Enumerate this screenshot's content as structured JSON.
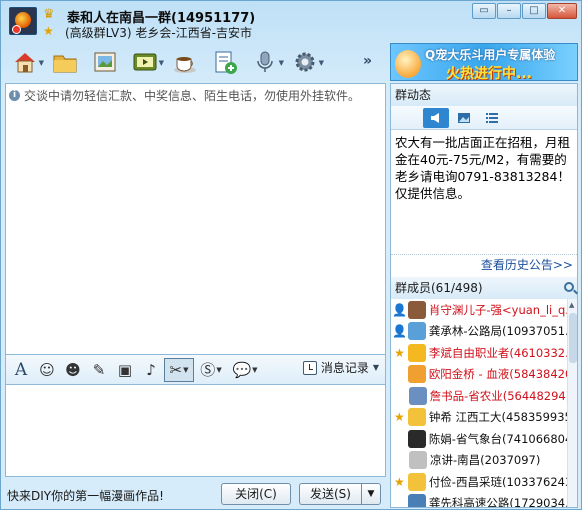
{
  "window": {
    "title": "泰和人在南昌一群(14951177)",
    "subtitle": "(高级群LV3) 老乡会-江西省-吉安市"
  },
  "toolbar": {
    "items": [
      {
        "name": "home-icon"
      },
      {
        "name": "folder-icon"
      },
      {
        "name": "photo-album-icon"
      },
      {
        "name": "video-icon"
      },
      {
        "name": "coffee-cup-icon"
      },
      {
        "name": "add-document-icon"
      },
      {
        "name": "microphone-icon"
      },
      {
        "name": "gear-icon"
      }
    ],
    "more": "»"
  },
  "ad": {
    "line1": "Q宠大乐斗用户专属体验",
    "line2": "火热进行中..."
  },
  "chat": {
    "notice": "交谈中请勿轻信汇款、中奖信息、陌生电话，勿使用外挂软件。"
  },
  "input_toolbar": {
    "message_record": "消息记录"
  },
  "bottom": {
    "hint": "快来DIY你的第一幅漫画作品!",
    "close_label": "关闭(C)",
    "send_label": "发送(S)"
  },
  "group_dynamic": {
    "title": "群动态",
    "announcement": "农大有一批店面正在招租，月租金在40元-75元/M2，有需要的老乡请电询0791-83813284！仅提供信息。",
    "history_link": "查看历史公告>>"
  },
  "members": {
    "title": "群成员(61/498)",
    "list": [
      {
        "name": "肖守渊儿子-强<yuan_li_q...",
        "color": "#d0101a",
        "badge": "person",
        "avatar": "#8a5a3a"
      },
      {
        "name": "龚承林-公路局(10937051...",
        "color": "#111111",
        "badge": "person",
        "avatar": "#5aa0d8"
      },
      {
        "name": "李斌自由职业者(4610332...",
        "color": "#d0101a",
        "badge": "star",
        "avatar": "#f4b820"
      },
      {
        "name": "欧阳金桥 - 血液(58438420)",
        "color": "#d0101a",
        "badge": "",
        "avatar": "#f0a030"
      },
      {
        "name": "詹书品-省农业(56448294)",
        "color": "#d0101a",
        "badge": "",
        "avatar": "#6a8fc0"
      },
      {
        "name": "钟希 江西工大(458359935)",
        "color": "#111111",
        "badge": "star",
        "avatar": "#f2c23a"
      },
      {
        "name": "陈娟-省气象台(741066804)",
        "color": "#111111",
        "badge": "",
        "avatar": "#2a2a2a"
      },
      {
        "name": "凉讲-南昌(2037097)",
        "color": "#111111",
        "badge": "",
        "avatar": "#c0c0c0"
      },
      {
        "name": "付俭-西昌采琏(103376243)",
        "color": "#111111",
        "badge": "star",
        "avatar": "#f2c23a"
      },
      {
        "name": "龚先科高速公路(1729034...",
        "color": "#111111",
        "badge": "",
        "avatar": "#4a7fb5"
      }
    ]
  }
}
